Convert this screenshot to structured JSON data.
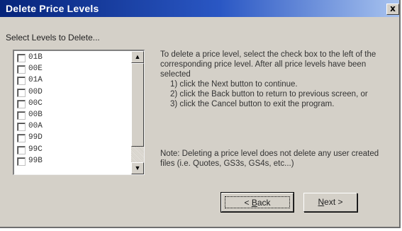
{
  "window": {
    "title": "Delete Price Levels",
    "close_glyph": "x"
  },
  "levels_section": {
    "label": "Select Levels to Delete...",
    "items": [
      {
        "label": "01B",
        "checked": false
      },
      {
        "label": "00E",
        "checked": false
      },
      {
        "label": "01A",
        "checked": false
      },
      {
        "label": "00D",
        "checked": false
      },
      {
        "label": "00C",
        "checked": false
      },
      {
        "label": "00B",
        "checked": false
      },
      {
        "label": "00A",
        "checked": false
      },
      {
        "label": "99D",
        "checked": false
      },
      {
        "label": "99C",
        "checked": false
      },
      {
        "label": "99B",
        "checked": false
      }
    ],
    "scroll_up_glyph": "▲",
    "scroll_down_glyph": "▼"
  },
  "instructions": {
    "intro": "To delete a price level, select the check box to the left of the corresponding price level. After all price levels have been selected",
    "steps": [
      "1) click the Next button to continue.",
      "2) click the Back button to return to previous screen, or",
      "3) click the Cancel button to exit the program."
    ],
    "note": "Note: Deleting a price level does not delete any user created files (i.e. Quotes, GS3s, GS4s, etc...)"
  },
  "buttons": {
    "back_prefix": "< ",
    "back_accel": "B",
    "back_rest": "ack",
    "next_accel": "N",
    "next_rest": "ext >"
  }
}
